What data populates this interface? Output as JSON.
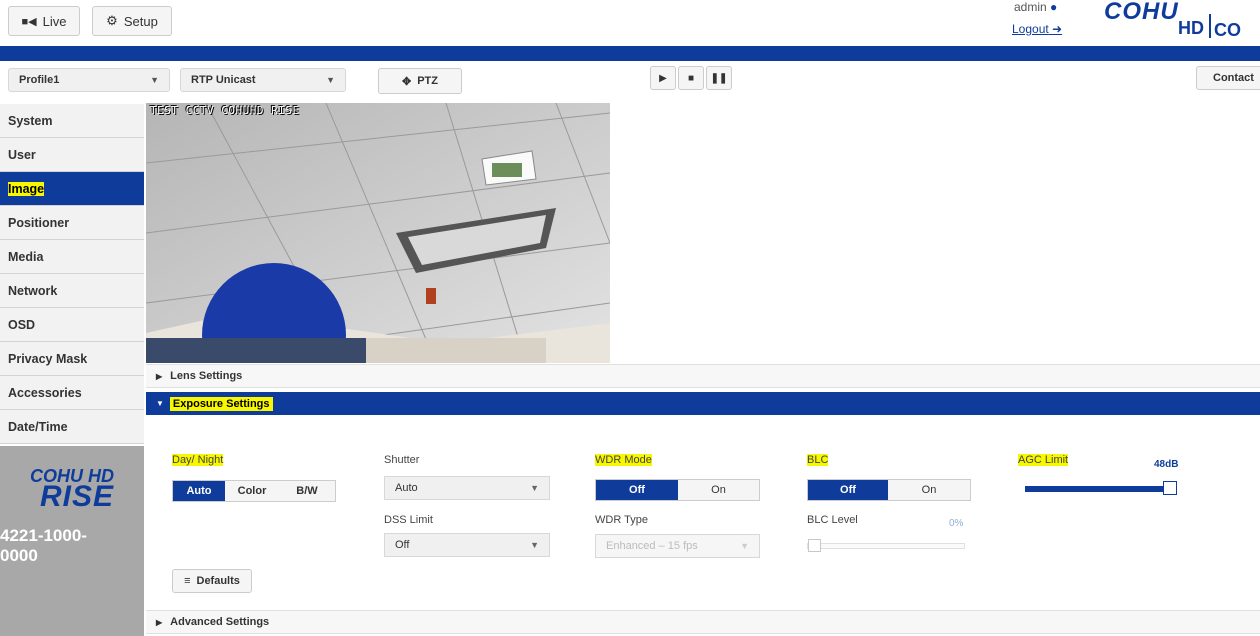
{
  "header": {
    "live_label": "Live",
    "setup_label": "Setup",
    "user_label": "admin",
    "logout_label": "Logout",
    "logo_top": "COHU",
    "logo_bottom": "HD",
    "logo_right": "CO",
    "contact_label": "Contact"
  },
  "toolbar": {
    "profile_value": "Profile1",
    "stream_value": "RTP Unicast",
    "ptz_label": "PTZ"
  },
  "video": {
    "overlay_text": "TEST CCTV COHUHD RISE"
  },
  "sidebar": {
    "items": [
      {
        "label": "System"
      },
      {
        "label": "User"
      },
      {
        "label": "Image"
      },
      {
        "label": "Positioner"
      },
      {
        "label": "Media"
      },
      {
        "label": "Network"
      },
      {
        "label": "OSD"
      },
      {
        "label": "Privacy Mask"
      },
      {
        "label": "Accessories"
      },
      {
        "label": "Date/Time"
      }
    ],
    "brand_top": "COHU HD",
    "brand_bottom": "RISE",
    "model": "4221-1000-0000"
  },
  "sections": {
    "lens": "Lens Settings",
    "exposure": "Exposure Settings",
    "advanced": "Advanced Settings"
  },
  "exposure": {
    "daynight_label": "Day/ Night",
    "daynight_options": [
      "Auto",
      "Color",
      "B/W"
    ],
    "shutter_label": "Shutter",
    "shutter_value": "Auto",
    "dss_label": "DSS Limit",
    "dss_value": "Off",
    "wdr_label": "WDR Mode",
    "wdr_options": [
      "Off",
      "On"
    ],
    "wdr_type_label": "WDR Type",
    "wdr_type_value": "Enhanced – 15 fps",
    "blc_label": "BLC",
    "blc_options": [
      "Off",
      "On"
    ],
    "blc_level_label": "BLC Level",
    "blc_level_value": "0%",
    "blc_level_fraction": 0,
    "agc_label": "AGC Limit",
    "agc_value": "48dB",
    "agc_fraction": 1.0,
    "defaults_label": "Defaults"
  },
  "colors": {
    "primary_blue": "#0f3c9b",
    "highlight": "#f7f700"
  }
}
